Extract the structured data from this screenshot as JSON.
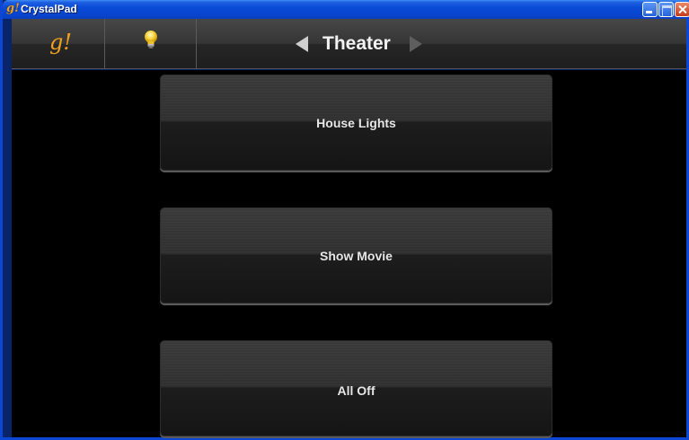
{
  "window": {
    "title": "CrystalPad",
    "icon_text": "g!"
  },
  "toolbar": {
    "logo_text": "g!",
    "bulb_icon": "lightbulb-icon",
    "page_title": "Theater",
    "prev_icon": "triangle-left-icon",
    "next_icon": "triangle-right-icon"
  },
  "scenes": [
    {
      "label": "House Lights"
    },
    {
      "label": "Show Movie"
    },
    {
      "label": "All Off"
    }
  ],
  "colors": {
    "accent": "#f0a020",
    "titlebar": "#0a4bd6",
    "background": "#000000"
  }
}
